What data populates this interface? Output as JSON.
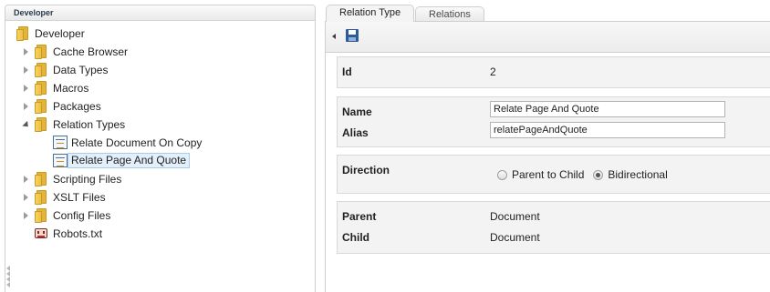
{
  "tree": {
    "header": "Developer",
    "root": "Developer",
    "items": [
      {
        "label": "Cache Browser"
      },
      {
        "label": "Data Types"
      },
      {
        "label": "Macros"
      },
      {
        "label": "Packages"
      },
      {
        "label": "Relation Types"
      },
      {
        "label": "Relate Document On Copy"
      },
      {
        "label": "Relate Page And Quote"
      },
      {
        "label": "Scripting Files"
      },
      {
        "label": "XSLT Files"
      },
      {
        "label": "Config Files"
      },
      {
        "label": "Robots.txt"
      }
    ]
  },
  "tabs": [
    "Relation Type",
    "Relations"
  ],
  "form": {
    "id_label": "Id",
    "id_value": "2",
    "name_label": "Name",
    "name_value": "Relate Page And Quote",
    "alias_label": "Alias",
    "alias_value": "relatePageAndQuote",
    "direction_label": "Direction",
    "direction_options": [
      "Parent to Child",
      "Bidirectional"
    ],
    "direction_selected": "Bidirectional",
    "parent_label": "Parent",
    "parent_value": "Document",
    "child_label": "Child",
    "child_value": "Document"
  }
}
